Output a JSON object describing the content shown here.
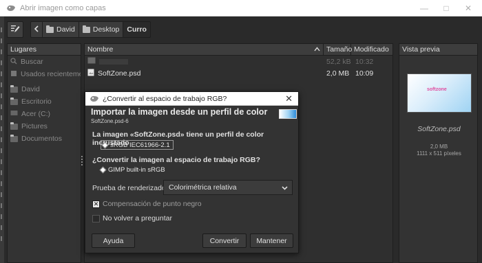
{
  "window": {
    "title": "Abrir imagen como capas",
    "controls": [
      "—",
      "□",
      "✕"
    ]
  },
  "toolbar": {
    "edit_icon": "edit-location-icon",
    "back_icon": "chevron-left-icon",
    "path": [
      {
        "label": "David",
        "icon": "folder-icon"
      },
      {
        "label": "Desktop",
        "icon": "folder-icon"
      },
      {
        "label": "Curro",
        "icon": ""
      }
    ]
  },
  "places": {
    "header": "Lugares",
    "items": [
      {
        "label": "Buscar",
        "icon": "search-icon"
      },
      {
        "label": "Usados recienteme...",
        "icon": "recent-icon"
      },
      {
        "label": "David",
        "icon": "folder-icon"
      },
      {
        "label": "Escritorio",
        "icon": "folder-icon"
      },
      {
        "label": "Acer (C:)",
        "icon": "drive-icon"
      },
      {
        "label": "Pictures",
        "icon": "folder-icon"
      },
      {
        "label": "Documentos",
        "icon": "folder-icon"
      }
    ]
  },
  "files": {
    "columns": {
      "name": "Nombre",
      "size": "Tamaño",
      "modified": "Modificado"
    },
    "rows": [
      {
        "name": "",
        "size": "52,2 kB",
        "modified": "10:32",
        "dim": true
      },
      {
        "name": "SoftZone.psd",
        "size": "2,0 MB",
        "modified": "10:09",
        "dim": false
      }
    ]
  },
  "preview": {
    "header": "Vista previa",
    "thumb_text": "softzone",
    "filename": "SoftZone.psd",
    "size": "2,0 MB",
    "dimensions": "1111 x 511 píxeles"
  },
  "dialog": {
    "title": "¿Convertir al espacio de trabajo RGB?",
    "close": "✕",
    "heading": "Importar la imagen desde un perfil de color",
    "subheading": "SoftZone.psd-6",
    "embedded_text": "La imagen «SoftZone.psd» tiene un perfil de color incrustado",
    "embedded_profile": "sRGB IEC61966-2.1",
    "convert_question": "¿Convertir la imagen al espacio de trabajo RGB?",
    "working_profile": "GIMP built-in sRGB",
    "render_label": "Prueba de renderizado:",
    "render_value": "Colorimétrica relativa",
    "black_point": "Compensación de punto negro",
    "dont_ask": "No volver a preguntar",
    "buttons": {
      "help": "Ayuda",
      "convert": "Convertir",
      "keep": "Mantener"
    }
  }
}
